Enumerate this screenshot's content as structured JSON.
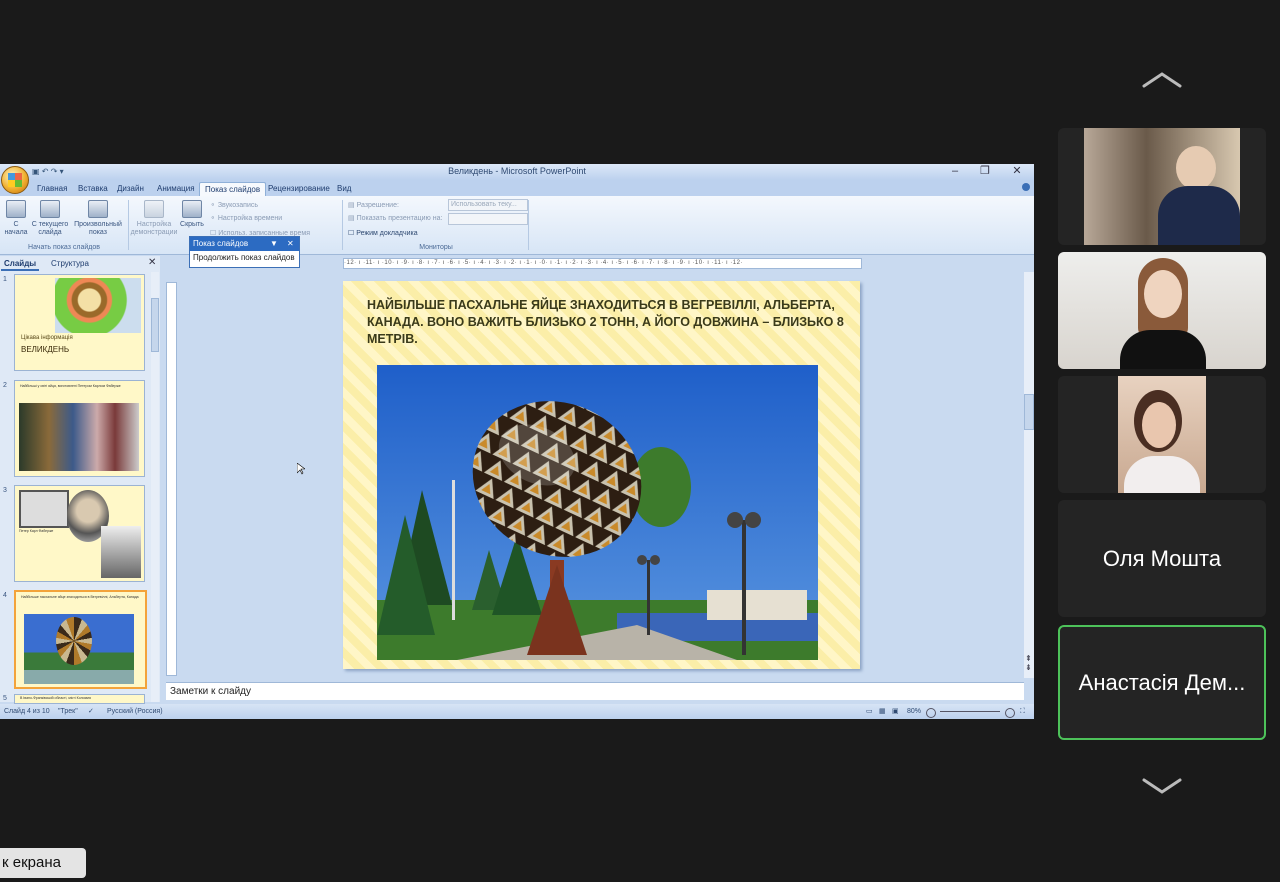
{
  "window": {
    "title": "Великдень - Microsoft PowerPoint"
  },
  "tabs": [
    "Главная",
    "Вставка",
    "Дизайн",
    "Анимация",
    "Показ слайдов",
    "Рецензирование",
    "Вид"
  ],
  "active_tab": "Показ слайдов",
  "ribbon": {
    "from_start": "С начала",
    "from_current": "С текущего слайда",
    "custom_show": "Произвольный показ",
    "group_start": "Начать показ слайдов",
    "setup": "Настройка демонстрации",
    "hide": "Скрыть",
    "record_narration": "Звукозапись",
    "rehearse": "Настройка времени",
    "use_timings": "Использ. записанные время",
    "resolution": "Разрешение:",
    "resolution_value": "Использовать теку...",
    "show_on": "Показать презентацию на:",
    "presenter_view": "Режим докладчика",
    "group_monitors": "Мониторы"
  },
  "popup": {
    "title": "Показ слайдов",
    "item": "Продолжить показ слайдов"
  },
  "panel_tabs": {
    "slides": "Слайды",
    "outline": "Структура"
  },
  "thumbs": {
    "t1_small": "Цікава інформація",
    "t1_title": "ВЕЛИКДЕНЬ",
    "t2_text": "Найбільші у світі яйця, виготовлені Петером Карлом Фаберже",
    "t3_text": "Петер Карл Фаберже",
    "t4_text": "Найбільше пасхальне яйце знаходиться в Вегревіллі, Альберта, Канада",
    "t5_text": "В Івано-Франківській області, місті Коломия"
  },
  "ruler": "·12· ı ·11· ı ·10· ı ·9· ı ·8· ı ·7· ı ·6· ı ·5· ı ·4· ı ·3· ı ·2· ı ·1· ı ·0· ı ·1· ı ·2· ı ·3· ı ·4· ı ·5· ı ·6· ı ·7· ı ·8· ı ·9· ı ·10· ı ·11· ı ·12·",
  "slide": {
    "text": "Найбільше пасхальне яйце знаходиться в Вегревіллі, Альберта, Канада. Воно важить близько 2 тонн, а його довжина – близько 8 метрів."
  },
  "notes_placeholder": "Заметки к слайду",
  "status": {
    "slide_count": "Слайд 4 из 10",
    "theme": "\"Трек\"",
    "language": "Русский (Россия)",
    "zoom": "80%"
  },
  "participants": [
    {
      "name": "Оля Мошта"
    },
    {
      "name": "Анастасія Дем..."
    }
  ],
  "share_label": "к екрана",
  "colors": {
    "active_speaker_border": "#4dc25a",
    "ribbon_blue": "#2c6bc2"
  }
}
